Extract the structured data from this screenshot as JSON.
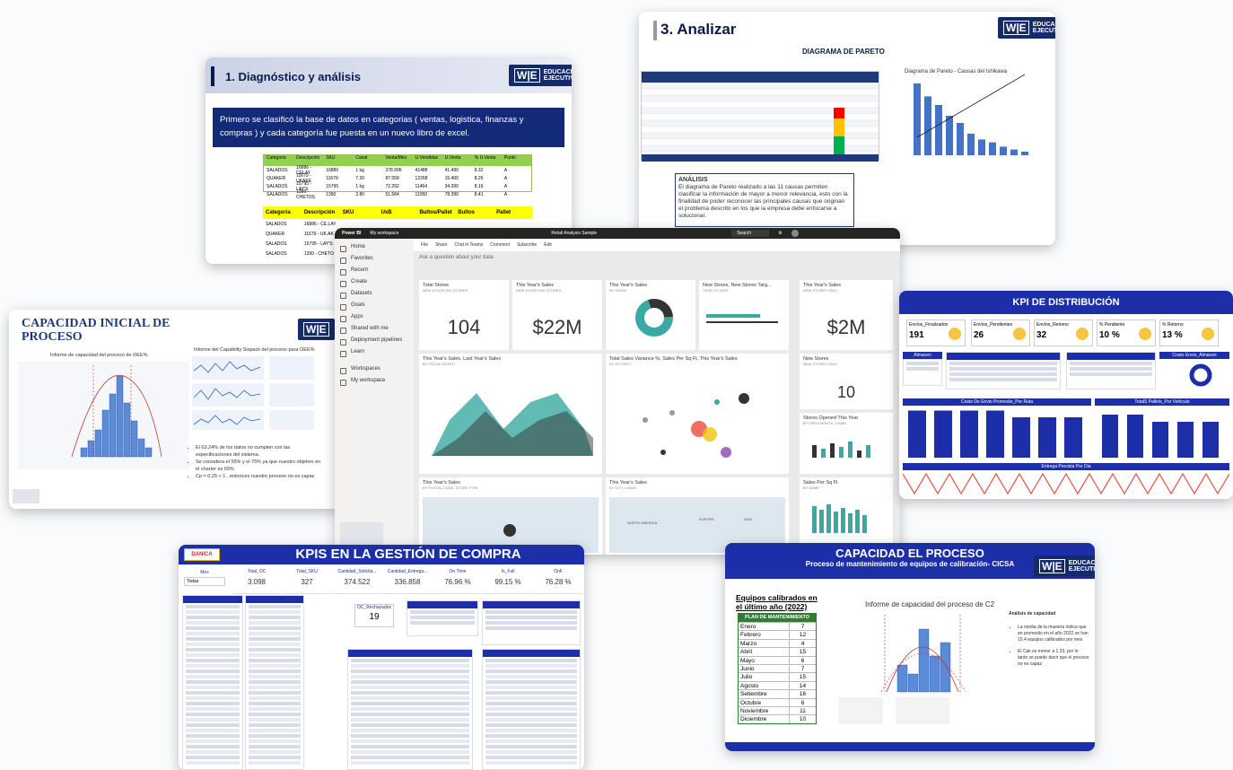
{
  "diagnostico": {
    "title": "1. Diagnóstico y análisis",
    "text": "Primero se clasificó la base de datos en categorias ( ventas, logistica, finanzas y compras ) y cada categoría fue puesta en un nuevo libro de excel.",
    "green_header": [
      "Categoria",
      "Descripción",
      "SKU",
      "Canal",
      "Venta/Mes",
      "U.Vendidas",
      "U.Venta",
      "% U.Venta",
      "Punto"
    ],
    "green_rows": [
      [
        "SALADOS",
        "16886 - CELAY",
        "16886",
        "1 kg",
        "378.996",
        "41488",
        "41.490",
        "8.32",
        "A"
      ],
      [
        "QUAKER",
        "11679 - UKAKE",
        "11679",
        "7.20",
        "87.558",
        "12268",
        "15.400",
        "8.26",
        "A"
      ],
      [
        "SALADOS",
        "15795 - LAY'S",
        "15795",
        "1 kg",
        "72.292",
        "11464",
        "34.390",
        "8.16",
        "A"
      ],
      [
        "SALADOS",
        "1390 - CHETOS",
        "1390",
        "2.80",
        "51.584",
        "11050",
        "78.390",
        "8.41",
        "A"
      ]
    ],
    "yellow_header": [
      "Categoria",
      "Descripción",
      "SKU",
      "UxB",
      "Bultos/Pallet",
      "Bultos",
      "Pallet"
    ],
    "yellow_rows": [
      [
        "SALADOS",
        "16886 - CE.LAY"
      ],
      [
        "QUAKER",
        "11679 - UK.AK"
      ],
      [
        "SALADOS",
        "15795 - LAY'S"
      ],
      [
        "SALADOS",
        "1390 - CHETO"
      ]
    ]
  },
  "analizar": {
    "title": "3. Analizar",
    "subtitle": "DIAGRAMA DE PARETO",
    "chart_title": "Diagrama de Pareto - Causas del Ishikawa",
    "analisis_title": "ANÁLISIS",
    "analisis_text": "El diagrama de Pareto realizado a las 11 causas permiten clasificar la información de mayor a menor relevancia, esto con la finalidad de poder reconocer las principales causas que originan el problema descrito en los que la empresa debe enfocarse a solucionar."
  },
  "capacidad_inicial": {
    "title_l1": "CAPACIDAD INICIAL DE",
    "title_l2": "PROCESO",
    "hist_title": "Informe de capacidad del proceso de OEE%",
    "capability_title": "Informe del Capability Sixpack del proceso para OEE%",
    "bullets": [
      "El 63.24% de los datos no cumplen con las especificaciones del sistema.",
      "Se considera el 55% y el 75% ya que nuestro objetivo en el charter es 65%",
      "Cp = 0.25 < 1 , entonces nuestro proceso no es capaz"
    ]
  },
  "powerbi": {
    "brand": "Power BI",
    "workspace": "My workspace",
    "report": "Retail Analysis Sample",
    "search": "Search",
    "toolbar": [
      "File",
      "Share",
      "Chat in Teams",
      "Comment",
      "Subscribe",
      "Edit"
    ],
    "qa": "Ask a question about your data",
    "nav": [
      "Home",
      "Favorites",
      "Recent",
      "Create",
      "Datasets",
      "Goals",
      "Apps",
      "Shared with me",
      "Deployment pipelines",
      "Learn",
      "Workspaces",
      "My workspace"
    ],
    "tiles": {
      "total_stores": {
        "title": "Total Stores",
        "sub": "NEW & EXISTING STORES",
        "value": "104"
      },
      "sales": {
        "title": "This Year's Sales",
        "sub": "NEW & EXISTING STORES",
        "value": "$22M"
      },
      "this_year": {
        "title": "This Year's Sales",
        "sub": "BY CHAIN"
      },
      "new_stores": {
        "title": "New Stores, New Stores Targ...",
        "sub": "YEAR TO DATE"
      },
      "new_sales": {
        "title": "This Year's Sales",
        "sub": "NEW STORES ONLY",
        "value": "$2M"
      },
      "area": {
        "title": "This Year's Sales, Last Year's Sales",
        "sub": "BY FISCAL MONTH"
      },
      "scatter": {
        "title": "Total Sales Variance %, Sales Per Sq Ft, This Year's Sales",
        "sub": "BY DISTRICT"
      },
      "newstores2": {
        "title": "New Stores",
        "sub": "NEW STORES ONLY",
        "value": "10"
      },
      "opened": {
        "title": "Stores Opened This Year",
        "sub": "BY OPEN MONTH, CHAIN"
      },
      "postal": {
        "title": "This Year's Sales",
        "sub": "BY POSTAL CODE, STORE TYPE"
      },
      "city": {
        "title": "This Year's Sales",
        "sub": "BY CITY, CHAIN"
      },
      "sqft": {
        "title": "Sales Per Sq Ft",
        "sub": "BY NAME"
      }
    },
    "map_labels": [
      "NORTH AMERICA",
      "EUROPE",
      "ASIA"
    ],
    "legend": [
      "This Year Sales",
      "Last Year Sales"
    ]
  },
  "kpi_dist": {
    "title": "KPI DE DISTRIBUCIÓN",
    "kpis": [
      {
        "label": "Envíos_Finalizados",
        "value": "191"
      },
      {
        "label": "Envíos_Pendientes",
        "value": "26"
      },
      {
        "label": "Envíos_Retorno",
        "value": "32"
      },
      {
        "label": "% Pendiente",
        "value": "10 %"
      },
      {
        "label": "% Retorno",
        "value": "13 %"
      }
    ],
    "almacen": "Almacen",
    "costo_envio": "Costo Envio_Almacen",
    "costo_ruta": "Costo De Envio Promedio_Por Ruta",
    "pallets": "TotalS Pallets_Por Vehiculo",
    "entrega": "Entrega Prevista Por Dia",
    "bar_values": [
      1.75,
      1.75,
      1.75,
      1.75,
      1.5,
      1.5,
      1.5
    ],
    "pallet_values": [
      3.0,
      3.0,
      2.5,
      2.5,
      2.5
    ]
  },
  "compras": {
    "logo": "DANICA",
    "title": "KPIS EN LA GESTIÓN DE COMPRA",
    "kpis": [
      {
        "label": "Total_OC",
        "value": "3.098"
      },
      {
        "label": "Total_SKU",
        "value": "327"
      },
      {
        "label": "Cantidad_Solicita...",
        "value": "374.522"
      },
      {
        "label": "Cantidad_Entrega...",
        "value": "336.858"
      },
      {
        "label": "On Time",
        "value": "76.96 %"
      },
      {
        "label": "In_Full",
        "value": "99.15 %"
      },
      {
        "label": "OnF",
        "value": "76.28 %"
      }
    ],
    "rechazados_label": "OC_Rechazados",
    "rechazados_value": "19",
    "filter_label": "Mes",
    "filter_value": "Todas"
  },
  "capacidad_proceso": {
    "title": "CAPACIDAD EL PROCESO",
    "subtitle": "Proceso de mantenimiento de equipos de calibración- CICSA",
    "eq_title_l1": "Equipos calibrados en",
    "eq_title_l2": "el último año (2022)",
    "plan_header": "PLAN DE MANTENIMIENTO",
    "months": [
      [
        "Enero",
        "7"
      ],
      [
        "Febrero",
        "12"
      ],
      [
        "Marzo",
        "4"
      ],
      [
        "Abril",
        "15"
      ],
      [
        "Mayo",
        "6"
      ],
      [
        "Junio",
        "7"
      ],
      [
        "Julio",
        "15"
      ],
      [
        "Agosto",
        "14"
      ],
      [
        "Setiembre",
        "16"
      ],
      [
        "Octubre",
        "6"
      ],
      [
        "Noviembre",
        "11"
      ],
      [
        "Diciembre",
        "10"
      ]
    ],
    "chart_title": "Informe de capacidad del proceso de C2",
    "analysis": "Análisis de capacidad",
    "notes": [
      "La media de la muestra indica que en promedio en el año 2022 se han 10.4 equipos calibrados por mes",
      "El Cpk es menor a 1.33, por lo tanto se puede decir que el proceso no es capaz"
    ]
  },
  "brand": {
    "we": "W|E",
    "we_sub": "EDUCACIÓN EJECUTIVA"
  },
  "colors": {
    "navy": "#142a6b",
    "blue": "#1d2fa8",
    "teal": "#3aa9a1",
    "green": "#2e7d32"
  }
}
